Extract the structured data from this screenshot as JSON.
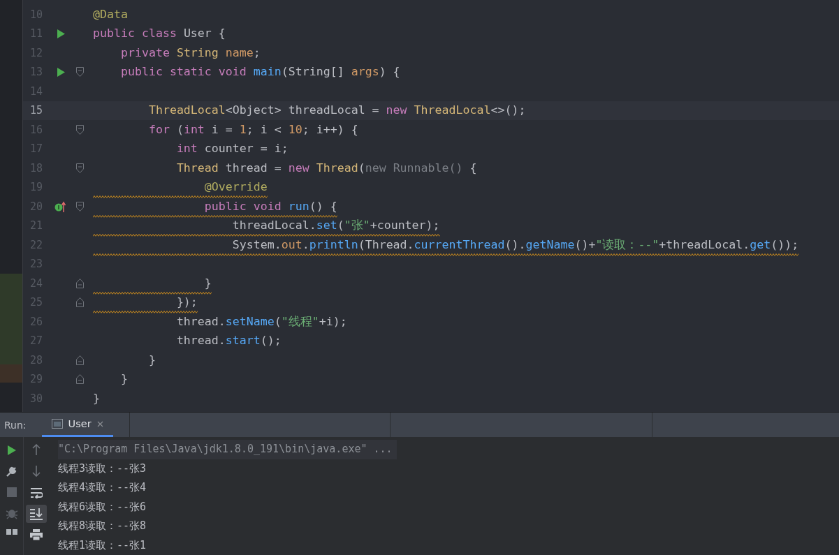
{
  "editor": {
    "lines": [
      {
        "number": "10",
        "selected": false,
        "runnable": false,
        "overrides": false,
        "fold_start": false,
        "fold_end": false,
        "warning": false,
        "tokens": [
          {
            "text": "@Data",
            "kind": "annotation"
          }
        ]
      },
      {
        "number": "11",
        "selected": false,
        "runnable": true,
        "overrides": false,
        "fold_start": false,
        "fold_end": false,
        "warning": false,
        "tokens": [
          {
            "text": "public class ",
            "kind": "keyword"
          },
          {
            "text": "User {",
            "kind": "plain"
          }
        ]
      },
      {
        "number": "12",
        "selected": false,
        "runnable": false,
        "overrides": false,
        "fold_start": false,
        "fold_end": false,
        "warning": false,
        "tokens": [
          {
            "text": "    private ",
            "kind": "keyword"
          },
          {
            "text": "String ",
            "kind": "type"
          },
          {
            "text": "name",
            "kind": "field"
          },
          {
            "text": ";",
            "kind": "plain"
          }
        ]
      },
      {
        "number": "13",
        "selected": false,
        "runnable": true,
        "overrides": false,
        "fold_start": true,
        "fold_end": false,
        "warning": false,
        "tokens": [
          {
            "text": "    public static void ",
            "kind": "keyword"
          },
          {
            "text": "main",
            "kind": "method"
          },
          {
            "text": "(String[] ",
            "kind": "plain"
          },
          {
            "text": "args",
            "kind": "field"
          },
          {
            "text": ") {",
            "kind": "plain"
          }
        ]
      },
      {
        "number": "14",
        "selected": false,
        "runnable": false,
        "overrides": false,
        "fold_start": false,
        "fold_end": false
      },
      {
        "number": "15",
        "selected": true,
        "runnable": false,
        "overrides": false,
        "fold_start": false,
        "fold_end": false,
        "warning": false,
        "tokens": [
          {
            "text": "        ThreadLocal",
            "kind": "type"
          },
          {
            "text": "<Object> threadLocal = ",
            "kind": "plain"
          },
          {
            "text": "new ",
            "kind": "keyword"
          },
          {
            "text": "ThreadLocal",
            "kind": "type"
          },
          {
            "text": "<>();",
            "kind": "plain"
          }
        ]
      },
      {
        "number": "16",
        "selected": false,
        "runnable": false,
        "overrides": false,
        "fold_start": true,
        "fold_end": false,
        "warning": false,
        "tokens": [
          {
            "text": "        for ",
            "kind": "keyword"
          },
          {
            "text": "(",
            "kind": "plain"
          },
          {
            "text": "int ",
            "kind": "keyword"
          },
          {
            "text": "i = ",
            "kind": "plain"
          },
          {
            "text": "1",
            "kind": "number"
          },
          {
            "text": "; i < ",
            "kind": "plain"
          },
          {
            "text": "10",
            "kind": "number"
          },
          {
            "text": "; i++) {",
            "kind": "plain"
          }
        ]
      },
      {
        "number": "17",
        "selected": false,
        "runnable": false,
        "overrides": false,
        "fold_start": false,
        "fold_end": false,
        "warning": false,
        "tokens": [
          {
            "text": "            int ",
            "kind": "keyword"
          },
          {
            "text": "counter = i;",
            "kind": "plain"
          }
        ]
      },
      {
        "number": "18",
        "selected": false,
        "runnable": false,
        "overrides": false,
        "fold_start": true,
        "fold_end": false,
        "warning": false,
        "tokens": [
          {
            "text": "            Thread ",
            "kind": "type"
          },
          {
            "text": "thread = ",
            "kind": "plain"
          },
          {
            "text": "new ",
            "kind": "keyword"
          },
          {
            "text": "Thread",
            "kind": "type"
          },
          {
            "text": "(",
            "kind": "plain"
          },
          {
            "text": "new Runnable() ",
            "kind": "gray"
          },
          {
            "text": "{",
            "kind": "plain"
          }
        ]
      },
      {
        "number": "19",
        "selected": false,
        "runnable": false,
        "overrides": false,
        "fold_start": false,
        "fold_end": false,
        "warning": true,
        "tokens": [
          {
            "text": "                @Override",
            "kind": "annotation"
          }
        ]
      },
      {
        "number": "20",
        "selected": false,
        "runnable": false,
        "overrides": true,
        "fold_start": true,
        "fold_end": false,
        "warning": true,
        "tokens": [
          {
            "text": "                public void ",
            "kind": "keyword"
          },
          {
            "text": "run",
            "kind": "method"
          },
          {
            "text": "() {",
            "kind": "plain"
          }
        ]
      },
      {
        "number": "21",
        "selected": false,
        "runnable": false,
        "overrides": false,
        "fold_start": false,
        "fold_end": false,
        "warning": true,
        "tokens": [
          {
            "text": "                    threadLocal.",
            "kind": "plain"
          },
          {
            "text": "set",
            "kind": "method"
          },
          {
            "text": "(",
            "kind": "plain"
          },
          {
            "text": "\"张\"",
            "kind": "string"
          },
          {
            "text": "+counter);",
            "kind": "plain"
          }
        ]
      },
      {
        "number": "22",
        "selected": false,
        "runnable": false,
        "overrides": false,
        "fold_start": false,
        "fold_end": false,
        "warning": true,
        "tokens": [
          {
            "text": "                    System.",
            "kind": "plain"
          },
          {
            "text": "out",
            "kind": "field"
          },
          {
            "text": ".",
            "kind": "plain"
          },
          {
            "text": "println",
            "kind": "method"
          },
          {
            "text": "(Thread.",
            "kind": "plain"
          },
          {
            "text": "currentThread",
            "kind": "method"
          },
          {
            "text": "().",
            "kind": "plain"
          },
          {
            "text": "getName",
            "kind": "method"
          },
          {
            "text": "()+",
            "kind": "plain"
          },
          {
            "text": "\"读取：--\"",
            "kind": "string"
          },
          {
            "text": "+threadLocal.",
            "kind": "plain"
          },
          {
            "text": "get",
            "kind": "method"
          },
          {
            "text": "());",
            "kind": "plain"
          }
        ]
      },
      {
        "number": "23",
        "selected": false,
        "runnable": false,
        "overrides": false,
        "fold_start": false,
        "fold_end": false
      },
      {
        "number": "24",
        "selected": false,
        "runnable": false,
        "overrides": false,
        "fold_start": false,
        "fold_end": true,
        "warning": true,
        "tokens": [
          {
            "text": "                }",
            "kind": "plain"
          }
        ]
      },
      {
        "number": "25",
        "selected": false,
        "runnable": false,
        "overrides": false,
        "fold_start": false,
        "fold_end": true,
        "warning": true,
        "tokens": [
          {
            "text": "            });",
            "kind": "plain"
          }
        ]
      },
      {
        "number": "26",
        "selected": false,
        "runnable": false,
        "overrides": false,
        "fold_start": false,
        "fold_end": false,
        "warning": false,
        "tokens": [
          {
            "text": "            thread.",
            "kind": "plain"
          },
          {
            "text": "setName",
            "kind": "method"
          },
          {
            "text": "(",
            "kind": "plain"
          },
          {
            "text": "\"线程\"",
            "kind": "string"
          },
          {
            "text": "+i);",
            "kind": "plain"
          }
        ]
      },
      {
        "number": "27",
        "selected": false,
        "runnable": false,
        "overrides": false,
        "fold_start": false,
        "fold_end": false,
        "warning": false,
        "tokens": [
          {
            "text": "            thread.",
            "kind": "plain"
          },
          {
            "text": "start",
            "kind": "method"
          },
          {
            "text": "();",
            "kind": "plain"
          }
        ]
      },
      {
        "number": "28",
        "selected": false,
        "runnable": false,
        "overrides": false,
        "fold_start": false,
        "fold_end": true,
        "warning": false,
        "tokens": [
          {
            "text": "        }",
            "kind": "plain"
          }
        ]
      },
      {
        "number": "29",
        "selected": false,
        "runnable": false,
        "overrides": false,
        "fold_start": false,
        "fold_end": true,
        "warning": false,
        "tokens": [
          {
            "text": "    }",
            "kind": "plain"
          }
        ]
      },
      {
        "number": "30",
        "selected": false,
        "runnable": false,
        "overrides": false,
        "fold_start": false,
        "fold_end": false,
        "warning": false,
        "tokens": [
          {
            "text": "}",
            "kind": "plain"
          }
        ]
      }
    ]
  },
  "run_panel": {
    "label": "Run:",
    "tabs": [
      {
        "label": "User",
        "selected": true,
        "closable": true
      }
    ],
    "console": [
      {
        "text": "\"C:\\Program Files\\Java\\jdk1.8.0_191\\bin\\java.exe\" ...",
        "kind": "command"
      },
      {
        "text": "线程3读取：--张3",
        "kind": "output"
      },
      {
        "text": "线程4读取：--张4",
        "kind": "output"
      },
      {
        "text": "线程6读取：--张6",
        "kind": "output"
      },
      {
        "text": "线程8读取：--张8",
        "kind": "output"
      },
      {
        "text": "线程1读取：--张1",
        "kind": "output"
      }
    ]
  }
}
